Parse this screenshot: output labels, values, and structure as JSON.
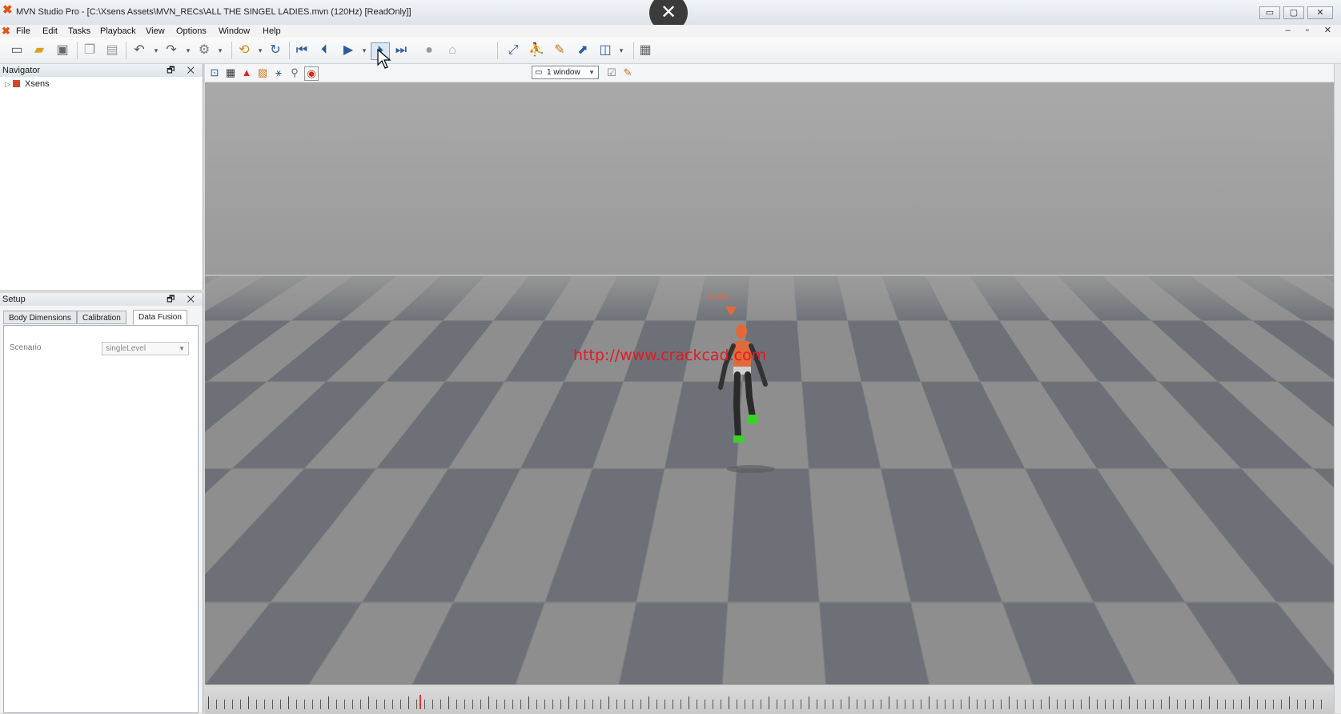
{
  "window": {
    "title": "MVN Studio Pro - [C:\\Xsens Assets\\MVN_RECs\\ALL THE SINGEL LADIES.mvn  (120Hz) [ReadOnly]]",
    "controls": [
      "▭",
      "▢",
      "✕"
    ]
  },
  "overlay": {
    "close_glyph": "✕"
  },
  "menu": {
    "items": [
      "File",
      "Edit",
      "Tasks",
      "Playback",
      "View",
      "Options",
      "Window",
      "Help"
    ],
    "mdi_controls": "– ▫ ✕"
  },
  "navigator": {
    "title": "Navigator",
    "controls": "🗗 ✕",
    "tree": [
      {
        "label": "Xsens"
      }
    ]
  },
  "setup": {
    "title": "Setup",
    "controls": "🗗 ✕",
    "tabs": [
      "Body Dimensions",
      "Calibration",
      "Data Fusion"
    ],
    "active_tab": "Data Fusion",
    "scenario_label": "Scenario",
    "scenario_value": "singleLevel"
  },
  "viewport_toolbar": {
    "window_select": "1 window"
  },
  "viewport": {
    "character_label": "Xsens",
    "watermark": "http://www.crackcad.com"
  },
  "icons": {
    "toolbar": [
      "new-file-icon",
      "open-folder-icon",
      "save-icon",
      "copy-icon",
      "paste-icon",
      "undo-icon",
      "redo-icon",
      "tools-icon",
      "connect-icon",
      "refresh-icon",
      "skip-start-icon",
      "step-back-icon",
      "play-icon",
      "step-forward-icon",
      "skip-end-icon",
      "record-icon",
      "tag-icon",
      "graph-icon",
      "figure-icon",
      "edit-icon",
      "chart-icon",
      "layout-icon",
      "screenshot-icon"
    ]
  },
  "colors": {
    "accent": "#2e5d9e",
    "character": "#e26a3a",
    "watermark": "#e01b24",
    "timeline_cursor": "#d23b3b"
  }
}
